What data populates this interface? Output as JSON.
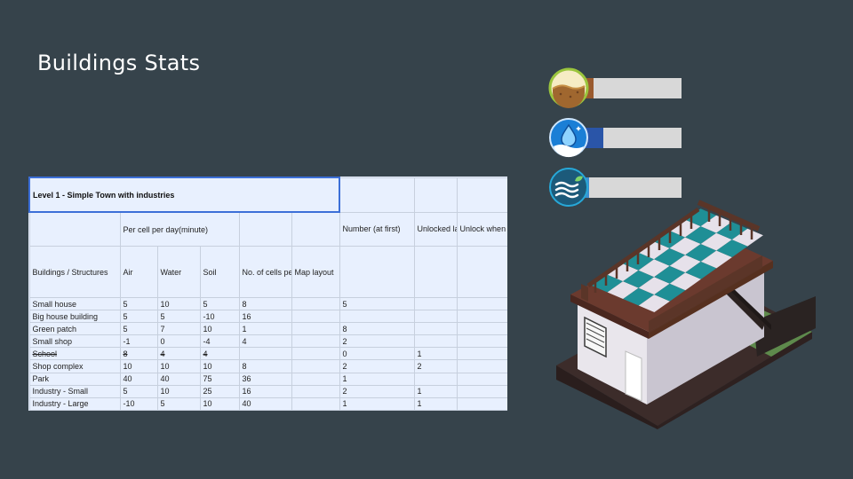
{
  "slide": {
    "title": "Buildings Stats"
  },
  "table": {
    "title": "Level 1 - Simple Town with industries",
    "group_header": "Per cell per day(minute)",
    "header_number": "Number (at first)",
    "header_unlocked": "Unlocked later",
    "header_unlock_how": "Unlock when and how?",
    "columns": [
      "Buildings / Structures",
      "Air",
      "Water",
      "Soil",
      "No. of cells per instance",
      "Map layout"
    ],
    "rows": [
      [
        "Small house",
        "5",
        "10",
        "5",
        "8",
        "",
        "5",
        "",
        ""
      ],
      [
        "Big house building",
        "5",
        "5",
        "-10",
        "16",
        "",
        "",
        "",
        ""
      ],
      [
        "Green patch",
        "5",
        "7",
        "10",
        "1",
        "",
        "8",
        "",
        ""
      ],
      [
        "Small shop",
        "-1",
        "0",
        "-4",
        "4",
        "",
        "2",
        "",
        ""
      ],
      [
        "School",
        "8",
        "4",
        "4",
        "",
        "",
        "0",
        "1",
        ""
      ],
      [
        "Shop complex",
        "10",
        "10",
        "10",
        "8",
        "",
        "2",
        "2",
        ""
      ],
      [
        "Park",
        "40",
        "40",
        "75",
        "36",
        "",
        "1",
        "",
        ""
      ],
      [
        "Industry - Small",
        "5",
        "10",
        "25",
        "16",
        "",
        "2",
        "1",
        ""
      ],
      [
        "Industry - Large",
        "-10",
        "5",
        "10",
        "40",
        "",
        "1",
        "1",
        ""
      ]
    ]
  },
  "gauges": [
    {
      "name": "soil",
      "icon": "soil-icon",
      "level": 0.1,
      "fill_color": "#9a5a2e",
      "ring_color": "#9bc53d"
    },
    {
      "name": "water",
      "icon": "water-drop-icon",
      "level": 0.2,
      "fill_color": "#2a55a8",
      "ring_color": "#1a88e0"
    },
    {
      "name": "air",
      "icon": "air-wave-icon",
      "level": 0.05,
      "fill_color": "#3e8fd0",
      "ring_color": "#27a8d8"
    }
  ]
}
